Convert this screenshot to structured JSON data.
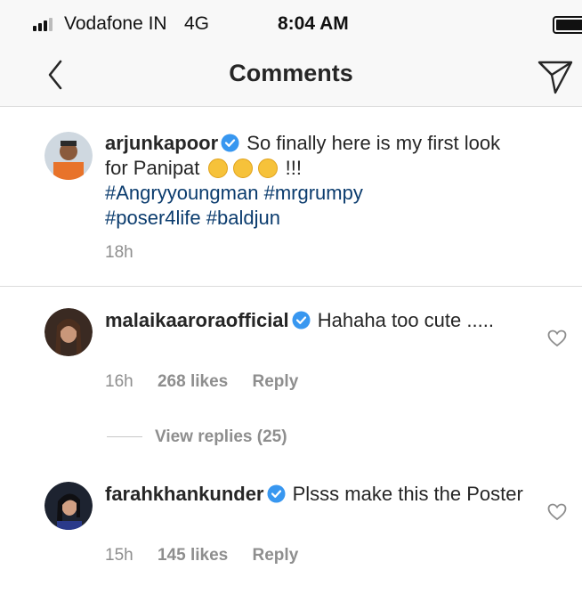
{
  "status_bar": {
    "carrier": "Vodafone IN",
    "network": "4G",
    "time": "8:04 AM"
  },
  "nav": {
    "title": "Comments",
    "back_icon": "chevron-left-icon",
    "share_icon": "paper-plane-icon"
  },
  "caption": {
    "username": "arjunkapoor",
    "text": "So finally here is my first look for Panipat",
    "emojis": [
      "wink-tongue-emoji",
      "tongue-emoji",
      "grin-emoji"
    ],
    "exclaim": "!!!",
    "hashtags": [
      "#Angryyoungman",
      "#mrgrumpy",
      "#poser4life",
      "#baldjun"
    ],
    "time": "18h"
  },
  "comments": [
    {
      "username": "malaikaaroraofficial",
      "text": "Hahaha too cute .....",
      "time": "16h",
      "likes": "268 likes",
      "reply": "Reply",
      "view_replies": "View replies (25)"
    },
    {
      "username": "farahkhankunder",
      "text": "Plsss make this the Poster",
      "time": "15h",
      "likes": "145 likes",
      "reply": "Reply"
    }
  ],
  "colors": {
    "hashtag": "#0b3c6e",
    "verified": "#3897f0",
    "meta": "#8e8e8e"
  }
}
